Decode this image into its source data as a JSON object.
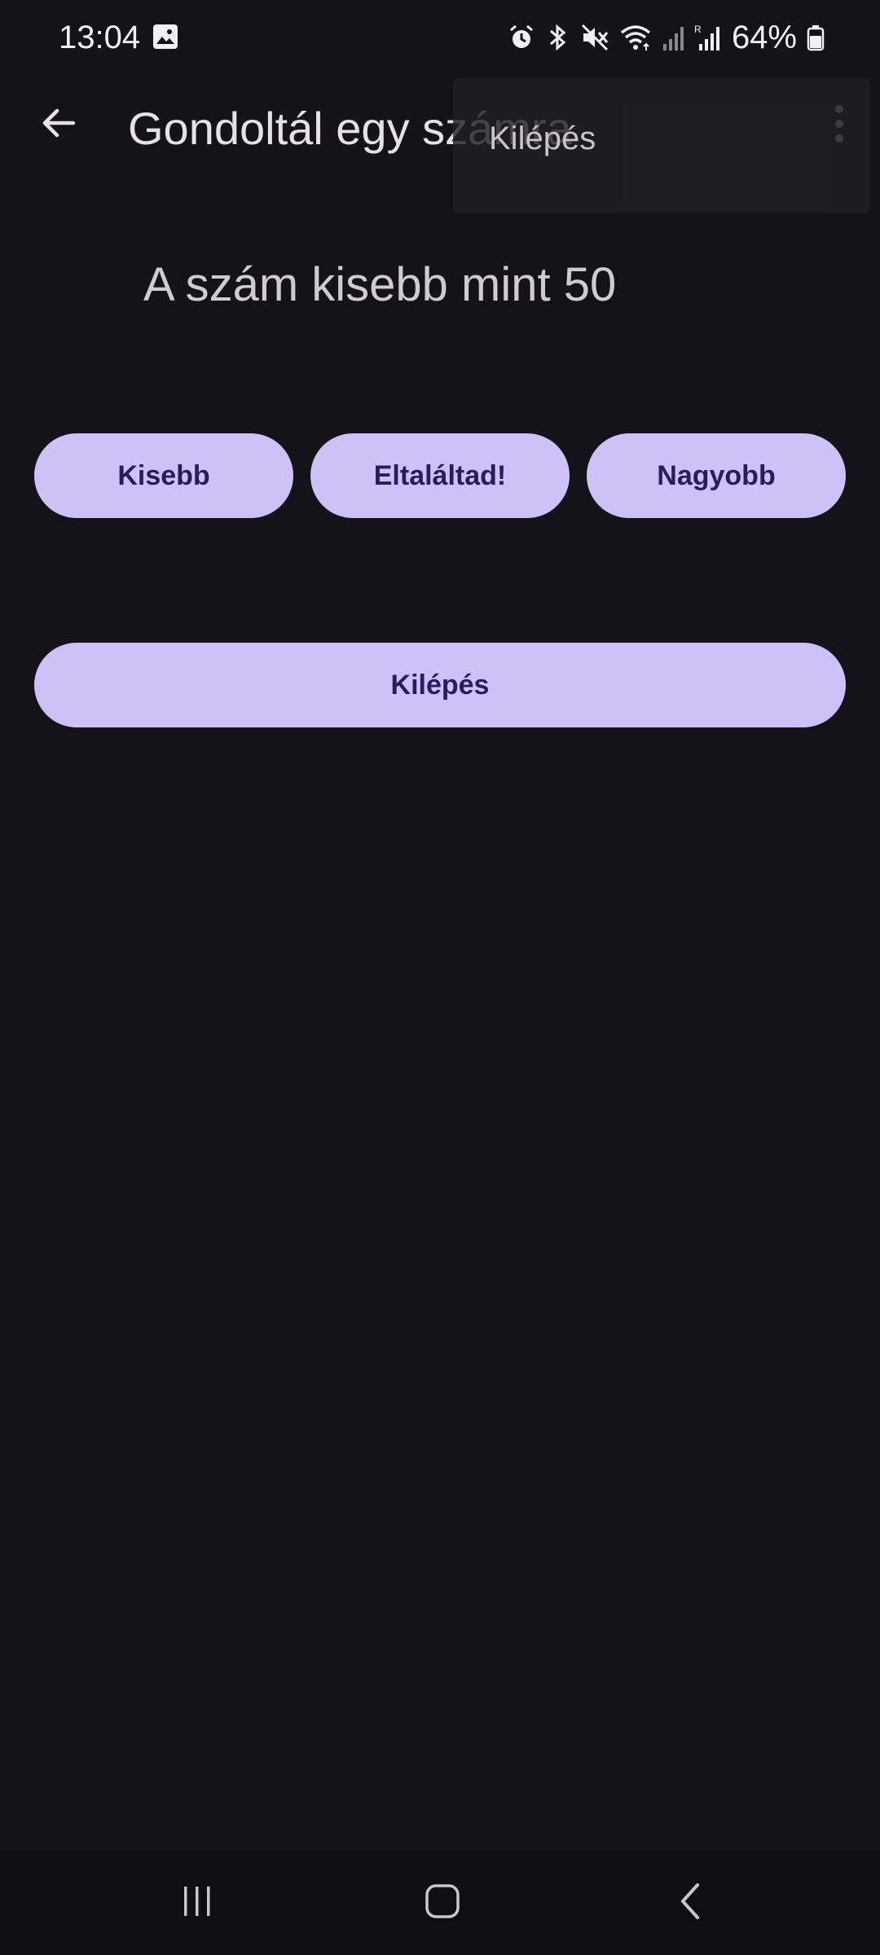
{
  "status_bar": {
    "time": "13:04",
    "battery": "64%",
    "icons": [
      "gallery-icon",
      "alarm-icon",
      "bluetooth-icon",
      "mute-icon",
      "wifi-icon",
      "signal-icon",
      "signal-roaming-icon",
      "battery-icon"
    ]
  },
  "app_bar": {
    "title": "Gondoltál egy számra",
    "back_icon": "arrow-back-icon",
    "overflow_icon": "more-vert-icon"
  },
  "menu": {
    "items": [
      {
        "label": "Kilépés"
      }
    ]
  },
  "main": {
    "message": "A szám kisebb mint 50",
    "buttons": {
      "smaller": "Kisebb",
      "correct": "Eltaláltad!",
      "bigger": "Nagyobb",
      "exit": "Kilépés"
    }
  },
  "nav_bar": {
    "icons": [
      "recents-icon",
      "home-icon",
      "back-icon"
    ]
  },
  "colors": {
    "background": "#15131a",
    "button_bg": "#cfc0f7",
    "button_text": "#2c1b5c",
    "menu_bg": "#211f26"
  }
}
